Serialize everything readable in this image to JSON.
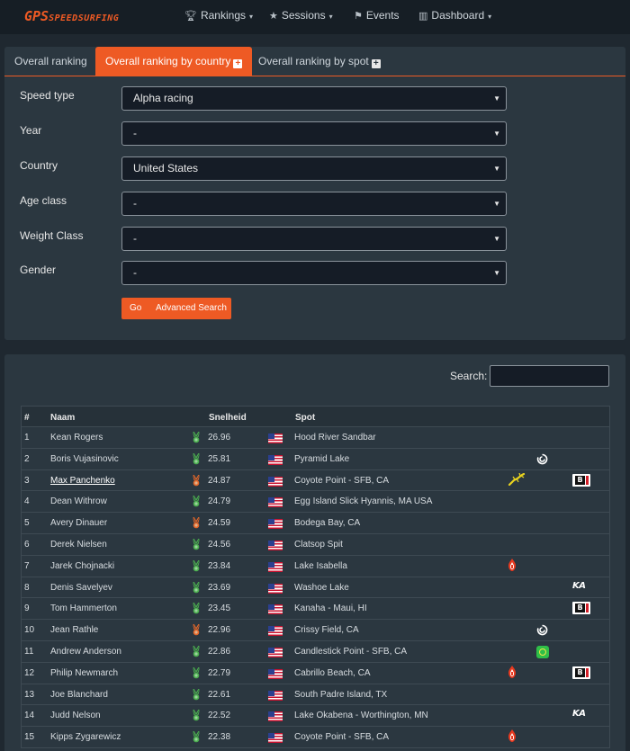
{
  "brand": {
    "logo_gps": "GPS",
    "logo_rest": "SPEEDSURFING"
  },
  "nav": {
    "rankings": "Rankings",
    "sessions": "Sessions",
    "events": "Events",
    "dashboard": "Dashboard",
    "caret": "▾"
  },
  "tabs": [
    {
      "label": "Overall ranking",
      "active": false
    },
    {
      "label": "Overall ranking by country",
      "active": true
    },
    {
      "label": "Overall ranking by spot",
      "active": false
    }
  ],
  "filters": [
    {
      "label": "Speed type",
      "value": "Alpha racing"
    },
    {
      "label": "Year",
      "value": "-"
    },
    {
      "label": "Country",
      "value": "United States"
    },
    {
      "label": "Age class",
      "value": "-"
    },
    {
      "label": "Weight Class",
      "value": "-"
    },
    {
      "label": "Gender",
      "value": "-"
    }
  ],
  "buttons": {
    "go": "Go",
    "advanced": "Advanced Search"
  },
  "search": {
    "label": "Search:",
    "value": ""
  },
  "table": {
    "headers": {
      "rank": "#",
      "name": "Naam",
      "speed": "Snelheid",
      "spot": "Spot"
    },
    "rows": [
      {
        "rank": "1",
        "name": "Kean Rogers",
        "speed": "26.96",
        "spot": "Hood River Sandbar",
        "medal": "green",
        "link": false
      },
      {
        "rank": "2",
        "name": "Boris Vujasinovic",
        "speed": "25.81",
        "spot": "Pyramid Lake",
        "medal": "green",
        "link": false,
        "b2": "swirl-icon"
      },
      {
        "rank": "3",
        "name": "Max Panchenko",
        "speed": "24.87",
        "spot": "Coyote Point - SFB, CA",
        "medal": "orange",
        "link": true,
        "b1": "gecko-icon",
        "b3": "b1-icon"
      },
      {
        "rank": "4",
        "name": "Dean Withrow",
        "speed": "24.79",
        "spot": "Egg Island Slick Hyannis, MA USA",
        "medal": "green",
        "link": false
      },
      {
        "rank": "5",
        "name": "Avery Dinauer",
        "speed": "24.59",
        "spot": "Bodega Bay, CA",
        "medal": "orange",
        "link": false
      },
      {
        "rank": "6",
        "name": "Derek Nielsen",
        "speed": "24.56",
        "spot": "Clatsop Spit",
        "medal": "green",
        "link": false
      },
      {
        "rank": "7",
        "name": "Jarek Chojnacki",
        "speed": "23.84",
        "spot": "Lake Isabella",
        "medal": "green",
        "link": false,
        "b1": "flame-icon"
      },
      {
        "rank": "8",
        "name": "Denis Savelyev",
        "speed": "23.69",
        "spot": "Washoe Lake",
        "medal": "green",
        "link": false,
        "b3": "ka-icon"
      },
      {
        "rank": "9",
        "name": "Tom Hammerton",
        "speed": "23.45",
        "spot": "Kanaha - Maui, HI",
        "medal": "green",
        "link": false,
        "b3": "b1-icon"
      },
      {
        "rank": "10",
        "name": "Jean Rathle",
        "speed": "22.96",
        "spot": "Crissy Field, CA",
        "medal": "orange",
        "link": false,
        "b2": "swirl-icon"
      },
      {
        "rank": "11",
        "name": "Andrew Anderson",
        "speed": "22.86",
        "spot": "Candlestick Point - SFB, CA",
        "medal": "green",
        "link": false,
        "b2": "green-ring-icon"
      },
      {
        "rank": "12",
        "name": "Philip Newmarch",
        "speed": "22.79",
        "spot": "Cabrillo Beach, CA",
        "medal": "green",
        "link": false,
        "b1": "flame-icon",
        "b3": "b1-icon"
      },
      {
        "rank": "13",
        "name": "Joe Blanchard",
        "speed": "22.61",
        "spot": "South Padre Island, TX",
        "medal": "green",
        "link": false
      },
      {
        "rank": "14",
        "name": "Judd Nelson",
        "speed": "22.52",
        "spot": "Lake Okabena - Worthington, MN",
        "medal": "green",
        "link": false,
        "b3": "ka-icon"
      },
      {
        "rank": "15",
        "name": "Kipps Zygarewicz",
        "speed": "22.38",
        "spot": "Coyote Point - SFB, CA",
        "medal": "green",
        "link": false,
        "b1": "flame-icon"
      }
    ]
  },
  "badge_text": {
    "b1": "B",
    "ka": "KA",
    "swirl": "࿋"
  },
  "colors": {
    "accent": "#ee5a24",
    "medal_green": "#4caf50",
    "medal_orange": "#e5672a",
    "panel": "#2b3740",
    "background": "#1f2830"
  }
}
